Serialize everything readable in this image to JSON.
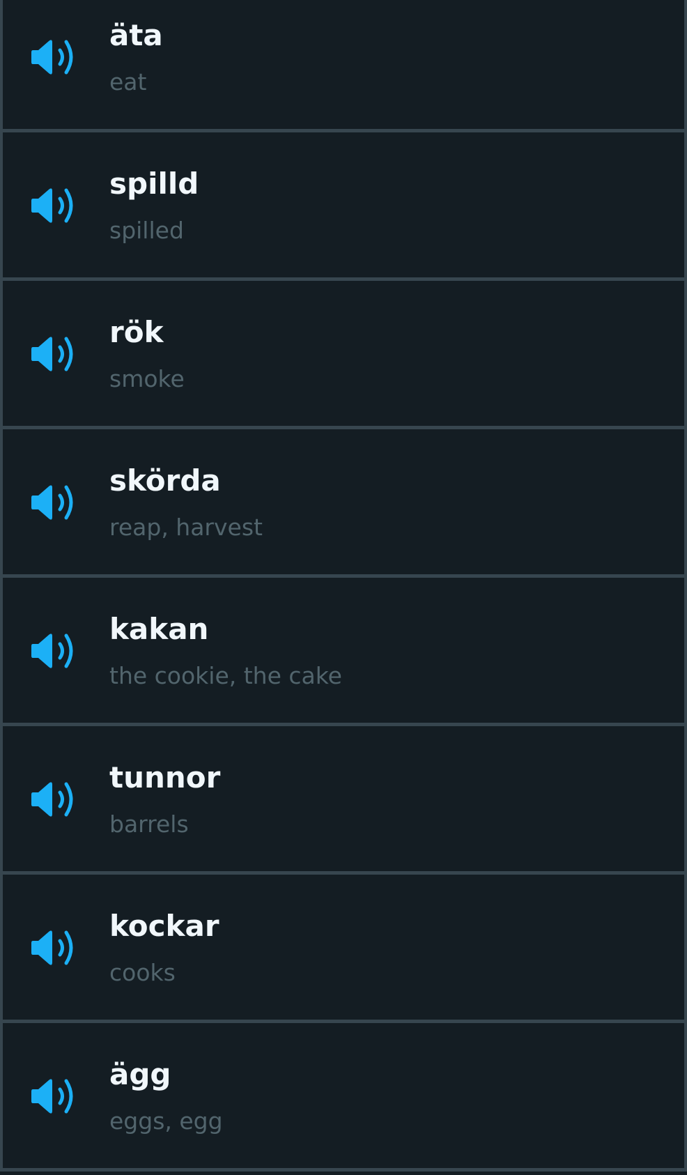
{
  "colors": {
    "background": "#141d23",
    "border": "#37464f",
    "accent": "#1cb0f6",
    "word": "#f1f7fb",
    "translation": "#52656d"
  },
  "icon": "speaker-icon",
  "items": [
    {
      "word": "äta",
      "translation": "eat"
    },
    {
      "word": "spilld",
      "translation": "spilled"
    },
    {
      "word": "rök",
      "translation": "smoke"
    },
    {
      "word": "skörda",
      "translation": "reap, harvest"
    },
    {
      "word": "kakan",
      "translation": "the cookie, the cake"
    },
    {
      "word": "tunnor",
      "translation": "barrels"
    },
    {
      "word": "kockar",
      "translation": "cooks"
    },
    {
      "word": "ägg",
      "translation": "eggs, egg"
    }
  ]
}
